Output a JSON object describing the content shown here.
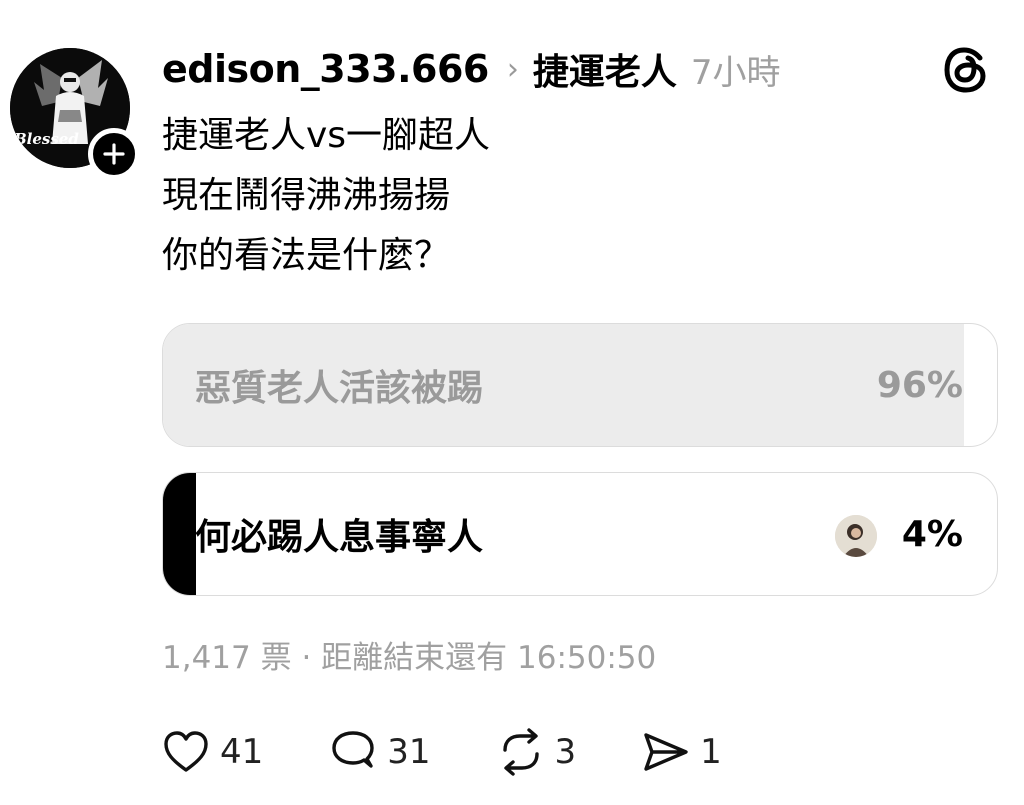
{
  "post": {
    "username": "edison_333.666",
    "separator": "›",
    "topic": "捷運老人",
    "time": "7小時",
    "avatar_text": "Blessed",
    "lines": [
      "捷運老人vs一腳超人",
      "現在鬧得沸沸揚揚",
      "你的看法是什麼？"
    ]
  },
  "poll": {
    "options": [
      {
        "label": "惡質老人活該被踢",
        "percent": "96%",
        "share": 0.96,
        "winner": false
      },
      {
        "label": "何必踢人息事寧人",
        "percent": "4%",
        "share": 0.04,
        "selected": true
      }
    ],
    "meta": "1,417 票 · 距離結束還有 16:50:50"
  },
  "actions": {
    "likes": "41",
    "comments": "31",
    "reposts": "3",
    "shares": "1"
  },
  "icons": {
    "follow": "plus-icon",
    "app": "threads-logo-icon",
    "like": "heart-icon",
    "comment": "comment-bubble-icon",
    "repost": "repost-icon",
    "share": "send-icon"
  },
  "colors": {
    "accent": "#000000",
    "muted_text": "#a0a0a0",
    "poll_fill_unselected": "#ececec",
    "poll_fill_selected": "#000000",
    "poll_text_unselected": "#9a9a9a"
  }
}
